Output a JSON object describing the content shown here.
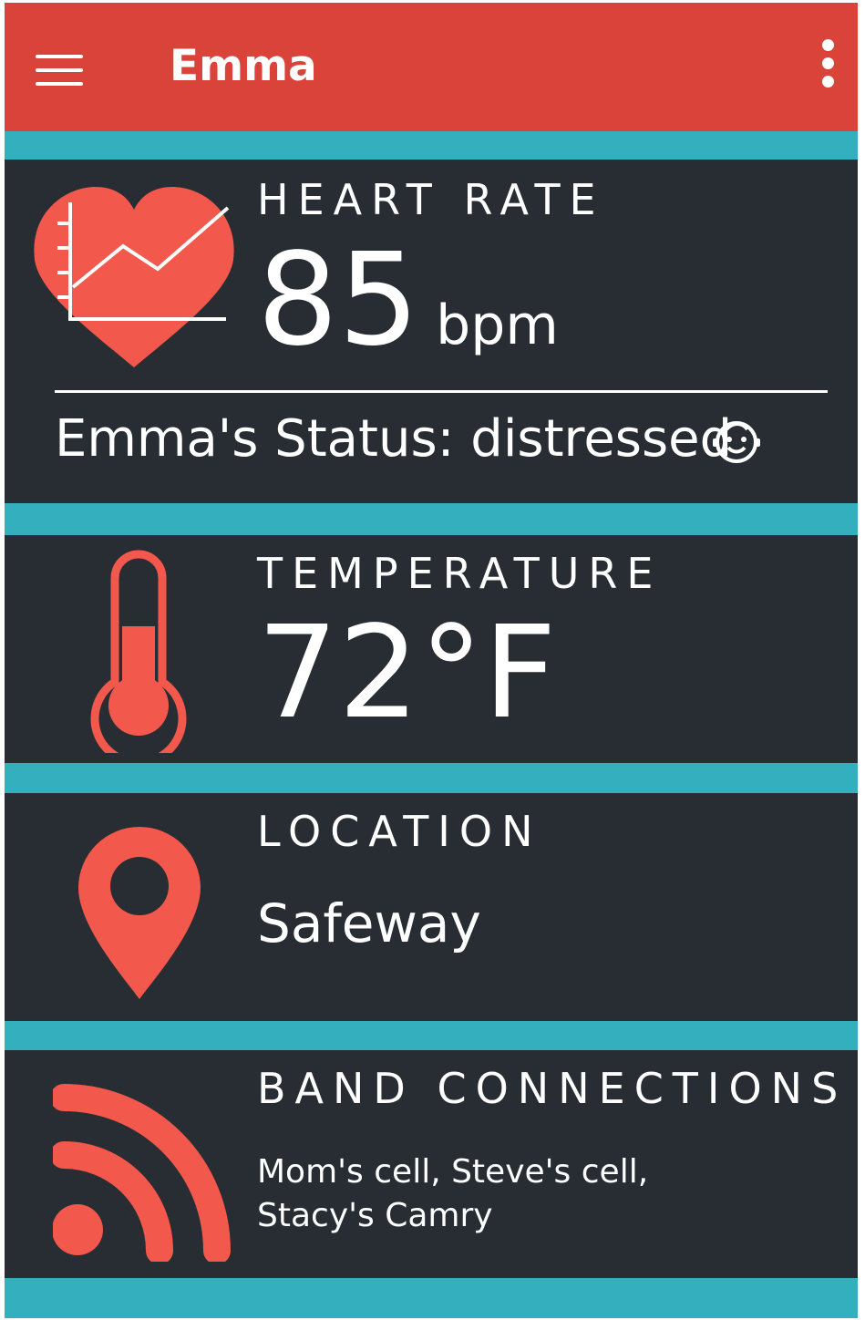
{
  "appbar": {
    "title": "Emma",
    "menu_icon": "hamburger-menu-icon",
    "more_icon": "more-vertical-icon"
  },
  "colors": {
    "appbar": "#d9433a",
    "accent_bar": "#33afbd",
    "card": "#272d32",
    "icon": "#f2584c",
    "text": "#ffffff"
  },
  "heart_rate": {
    "icon": "heart-chart-icon",
    "label": "HEART RATE",
    "value": "85",
    "unit": "bpm",
    "status_text": "Emma's Status: distressed",
    "status_icon": "baby-face-icon"
  },
  "temperature": {
    "icon": "thermometer-icon",
    "label": "TEMPERATURE",
    "value": "72°F"
  },
  "location": {
    "icon": "location-pin-icon",
    "label": "LOCATION",
    "value": "Safeway"
  },
  "band_connections": {
    "icon": "rss-signal-icon",
    "label": "BAND CONNECTIONS",
    "line1": "Mom's cell, Steve's cell,",
    "line2": "Stacy's Camry"
  }
}
